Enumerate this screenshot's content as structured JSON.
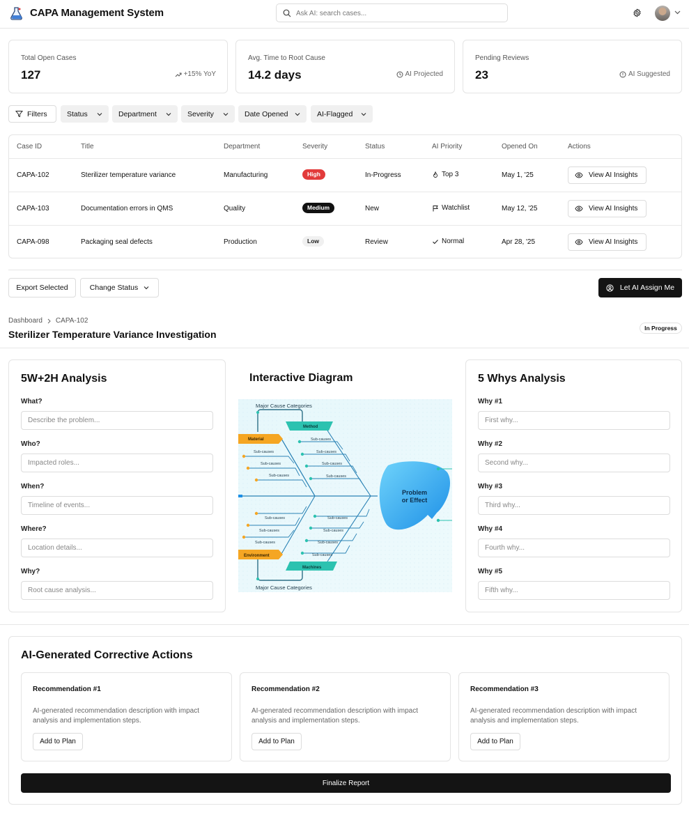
{
  "header": {
    "title": "CAPA Management System",
    "search_placeholder": "Ask AI: search cases...",
    "logo_icon": "lab-flask-icon",
    "settings_icon": "gear-icon"
  },
  "stats": [
    {
      "label": "Total Open Cases",
      "value": "127",
      "note": "+15% YoY",
      "icon": "trend-up-icon"
    },
    {
      "label": "Avg. Time to Root Cause",
      "value": "14.2 days",
      "note": "AI Projected",
      "icon": "clock-icon"
    },
    {
      "label": "Pending Reviews",
      "value": "23",
      "note": "AI Suggested",
      "icon": "alert-circle-icon"
    }
  ],
  "filters": {
    "filters_label": "Filters",
    "items": [
      "Status",
      "Department",
      "Severity",
      "Date Opened",
      "AI-Flagged"
    ]
  },
  "table": {
    "columns": [
      "Case ID",
      "Title",
      "Department",
      "Severity",
      "Status",
      "AI Priority",
      "Opened On",
      "Actions"
    ],
    "action_label": "View AI Insights",
    "rows": [
      {
        "id": "CAPA-102",
        "title": "Sterilizer temperature variance",
        "department": "Manufacturing",
        "severity": "High",
        "status": "In-Progress",
        "priority": "Top 3",
        "opened": "May 1, '25"
      },
      {
        "id": "CAPA-103",
        "title": "Documentation errors in QMS",
        "department": "Quality",
        "severity": "Medium",
        "status": "New",
        "priority": "Watchlist",
        "opened": "May 12, '25"
      },
      {
        "id": "CAPA-098",
        "title": "Packaging seal defects",
        "department": "Production",
        "severity": "Low",
        "status": "Review",
        "priority": "Normal",
        "opened": "Apr 28, '25"
      }
    ]
  },
  "bulk": {
    "export_label": "Export Selected",
    "change_status_label": "Change Status",
    "assign_label": "Let AI Assign Me"
  },
  "breadcrumb": [
    "Dashboard",
    "CAPA-102"
  ],
  "case": {
    "title": "Sterilizer Temperature Variance Investigation",
    "status": "In Progress"
  },
  "analysis": {
    "title": "5W+2H Analysis",
    "fields": [
      {
        "label": "What?",
        "placeholder": "Describe the problem..."
      },
      {
        "label": "Who?",
        "placeholder": "Impacted roles..."
      },
      {
        "label": "When?",
        "placeholder": "Timeline of events..."
      },
      {
        "label": "Where?",
        "placeholder": "Location details..."
      },
      {
        "label": "Why?",
        "placeholder": "Root cause analysis..."
      }
    ]
  },
  "diagram": {
    "title": "Interactive Diagram",
    "top_label": "Major Cause Categories",
    "bottom_label": "Major Cause Categories",
    "effect_line1": "Problem",
    "effect_line2": "or Effect",
    "categories": [
      "Method",
      "Material",
      "Environment",
      "Machines"
    ],
    "sub_label": "Sub-causes"
  },
  "whys": {
    "title": "5 Whys Analysis",
    "fields": [
      {
        "label": "Why #1",
        "placeholder": "First why..."
      },
      {
        "label": "Why #2",
        "placeholder": "Second why..."
      },
      {
        "label": "Why #3",
        "placeholder": "Third why..."
      },
      {
        "label": "Why #4",
        "placeholder": "Fourth why..."
      },
      {
        "label": "Why #5",
        "placeholder": "Fifth why..."
      }
    ]
  },
  "actions": {
    "title": "AI-Generated Corrective Actions",
    "recommendations": [
      {
        "title": "Recommendation #1",
        "desc": "AI-generated recommendation description with impact analysis and implementation steps.",
        "button": "Add to Plan"
      },
      {
        "title": "Recommendation #2",
        "desc": "AI-generated recommendation description with impact analysis and implementation steps.",
        "button": "Add to Plan"
      },
      {
        "title": "Recommendation #3",
        "desc": "AI-generated recommendation description with impact analysis and implementation steps.",
        "button": "Add to Plan"
      }
    ],
    "finalize_label": "Finalize Report"
  },
  "colors": {
    "accent_dark": "#141414",
    "high": "#e23b3b",
    "fish_blue": "#2b8fe0",
    "fish_teal": "#2cc2b0",
    "fish_orange": "#f5a623"
  }
}
